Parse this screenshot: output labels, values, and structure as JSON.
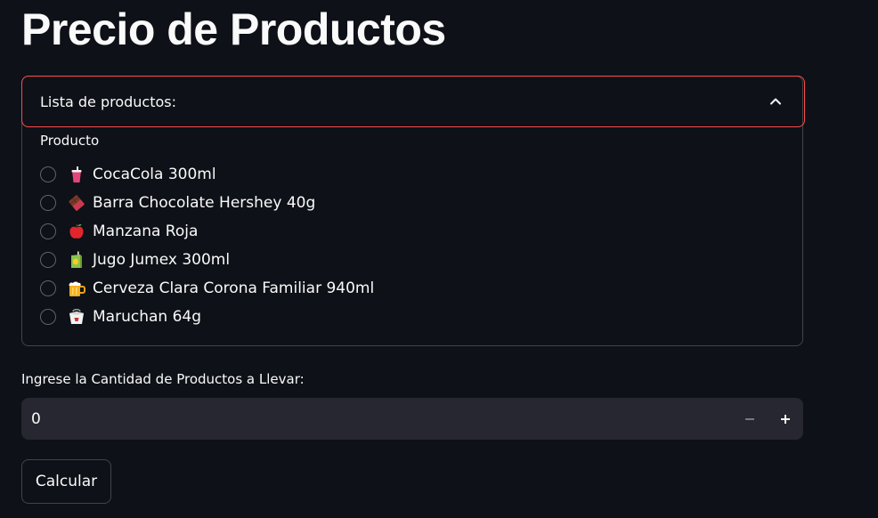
{
  "page": {
    "title": "Precio de Productos"
  },
  "expander": {
    "label": "Lista de productos:",
    "expanded": true,
    "chevron_icon": "chevron-up-icon",
    "border_color_active": "#ff4b4b"
  },
  "radio": {
    "label": "Producto",
    "options": [
      {
        "label": "CocaCola 300ml",
        "icon": "cup-with-straw-icon"
      },
      {
        "label": "Barra Chocolate Hershey 40g",
        "icon": "chocolate-bar-icon"
      },
      {
        "label": "Manzana Roja",
        "icon": "red-apple-icon"
      },
      {
        "label": "Jugo Jumex 300ml",
        "icon": "juice-box-icon"
      },
      {
        "label": "Cerveza Clara Corona Familiar 940ml",
        "icon": "beer-mug-icon"
      },
      {
        "label": "Maruchan 64g",
        "icon": "takeout-box-icon"
      }
    ],
    "selected_index": null
  },
  "quantity": {
    "label": "Ingrese la Cantidad de Productos a Llevar:",
    "value": "0",
    "decrement_icon": "minus-icon",
    "increment_icon": "plus-icon"
  },
  "actions": {
    "calculate_label": "Calcular"
  },
  "colors": {
    "background": "#0e1117",
    "text": "#fafafa",
    "input_bg": "#262730",
    "accent": "#ff4b4b"
  }
}
